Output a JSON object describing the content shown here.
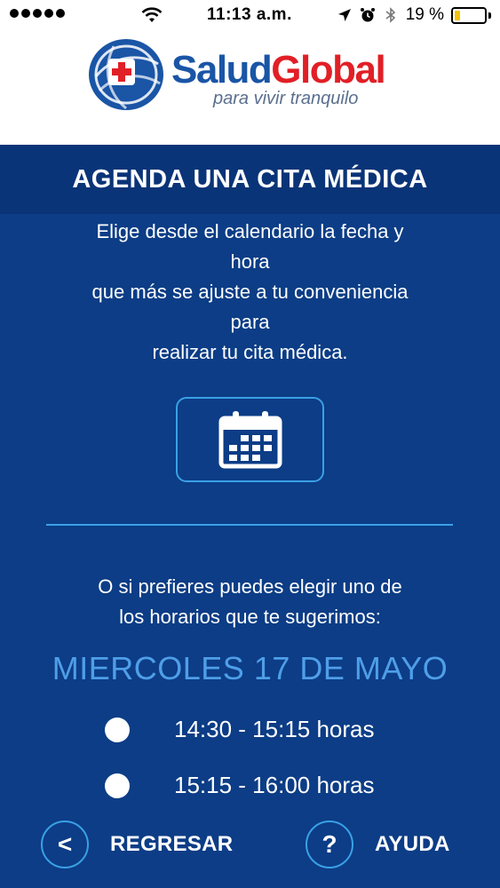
{
  "status_bar": {
    "time": "11:13 a.m.",
    "battery_percent": "19 %",
    "battery_level": 0.19,
    "icons": [
      "signal-dots-icon",
      "wifi-icon",
      "location-arrow-icon",
      "alarm-icon",
      "bluetooth-icon",
      "battery-icon"
    ]
  },
  "brand": {
    "name_part1": "Salud",
    "name_part2": "Global",
    "tagline": "para vivir tranquilo",
    "color_primary": "#1a55a6",
    "color_accent": "#e11f26"
  },
  "page": {
    "title": "AGENDA UNA CITA MÉDICA",
    "intro_lines": [
      "Elige desde el calendario la fecha y",
      "hora",
      "que más se ajuste a tu conveniencia",
      "para",
      "realizar tu cita médica."
    ],
    "calendar_button_icon": "calendar-icon",
    "suggest_lines": [
      "O si prefieres puedes elegir uno de",
      "los horarios que te sugerimos:"
    ],
    "date_label": "MIERCOLES 17 DE MAYO",
    "slots": [
      {
        "label": "14:30 - 15:15 horas"
      },
      {
        "label": "15:15 - 16:00 horas"
      }
    ]
  },
  "footer": {
    "back_glyph": "<",
    "back_label": "REGRESAR",
    "help_glyph": "?",
    "help_label": "AYUDA"
  },
  "colors": {
    "background": "#0c3d86",
    "title_band": "#0a3478",
    "accent_outline": "#3aa0e6",
    "date_label": "#4f9ee8",
    "battery_fill": "#f2c20b"
  }
}
